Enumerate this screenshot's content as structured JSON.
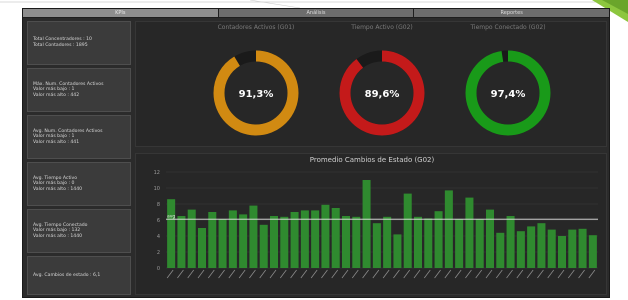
{
  "tabs": [
    {
      "label": "KPIs",
      "active": true
    },
    {
      "label": "Análisis",
      "active": false
    },
    {
      "label": "Reportes",
      "active": false
    }
  ],
  "stats": [
    {
      "lines": [
        "Total Concentradores : 10",
        "Total Contadores : 1895"
      ]
    },
    {
      "lines": [
        "Máx. Num. Contadores Activos",
        "Valor más bajo : 1",
        "Valor más alto : 442"
      ]
    },
    {
      "lines": [
        "Avg. Num. Contadores Activos",
        "Valor más bajo : 1",
        "Valor más alto : 441"
      ]
    },
    {
      "lines": [
        "Avg. Tiempo Activo",
        "Valor más bajo : 0",
        "Valor más alto : 1440"
      ]
    },
    {
      "lines": [
        "Avg. Tiempo Conectado",
        "Valor más bajo : 132",
        "Valor más alto : 1440"
      ]
    },
    {
      "lines": [
        "Avg. Cambios de estado : 6,1"
      ]
    }
  ],
  "gauges": [
    {
      "title": "Contadores Activos (G01)",
      "value_label": "91,3%",
      "value": 91.3,
      "color": "#d18a12"
    },
    {
      "title": "Tiempo Activo (G02)",
      "value_label": "89,6%",
      "value": 89.6,
      "color": "#c41a1a"
    },
    {
      "title": "Tiempo Conectado (G02)",
      "value_label": "97,4%",
      "value": 97.4,
      "color": "#199a19"
    }
  ],
  "chart_data": {
    "type": "bar",
    "title": "Promedio Cambios de Estado (G02)",
    "ylim": [
      0,
      12
    ],
    "yticks": [
      0,
      2,
      4,
      6,
      8,
      10,
      12
    ],
    "reference_line": {
      "value": 6.1,
      "label": "avg"
    },
    "bar_color": "#2f8a2f",
    "values": [
      8.6,
      6.5,
      7.3,
      5.0,
      7.0,
      6.1,
      7.2,
      6.7,
      7.8,
      5.4,
      6.5,
      6.4,
      7.0,
      7.2,
      7.2,
      7.9,
      7.5,
      6.5,
      6.4,
      11.0,
      5.6,
      6.4,
      4.2,
      9.3,
      6.4,
      6.2,
      7.1,
      9.7,
      6.1,
      8.8,
      6.1,
      7.3,
      4.4,
      6.5,
      4.6,
      5.2,
      5.6,
      4.8,
      4.0,
      4.8,
      4.9,
      4.1
    ]
  }
}
